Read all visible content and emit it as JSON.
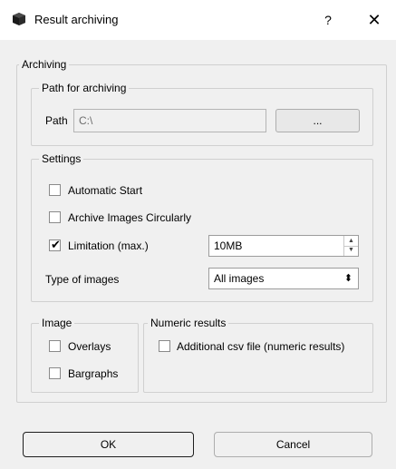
{
  "window": {
    "title": "Result archiving",
    "help_label": "?",
    "close_label": "✕"
  },
  "archiving": {
    "legend": "Archiving",
    "path_group": {
      "legend": "Path for archiving",
      "path_label": "Path",
      "path_value": "C:\\",
      "browse_label": "..."
    },
    "settings": {
      "legend": "Settings",
      "automatic_start": {
        "label": "Automatic Start",
        "checked": false
      },
      "archive_circular": {
        "label": "Archive Images Circularly",
        "checked": false
      },
      "limitation": {
        "label": "Limitation (max.)",
        "checked": true,
        "value": "10MB"
      },
      "type_of_images": {
        "label": "Type of images",
        "selected": "All images"
      }
    },
    "image_group": {
      "legend": "Image",
      "overlays": {
        "label": "Overlays",
        "checked": false
      },
      "bargraphs": {
        "label": "Bargraphs",
        "checked": false
      }
    },
    "numeric_group": {
      "legend": "Numeric results",
      "csv": {
        "label": "Additional csv file (numeric results)",
        "checked": false
      }
    }
  },
  "footer": {
    "ok_label": "OK",
    "cancel_label": "Cancel"
  },
  "icons": {
    "app": "camera-icon",
    "checkmark": "✔",
    "spin_up": "▲",
    "spin_down": "▼",
    "select_arrows": "⬍"
  }
}
